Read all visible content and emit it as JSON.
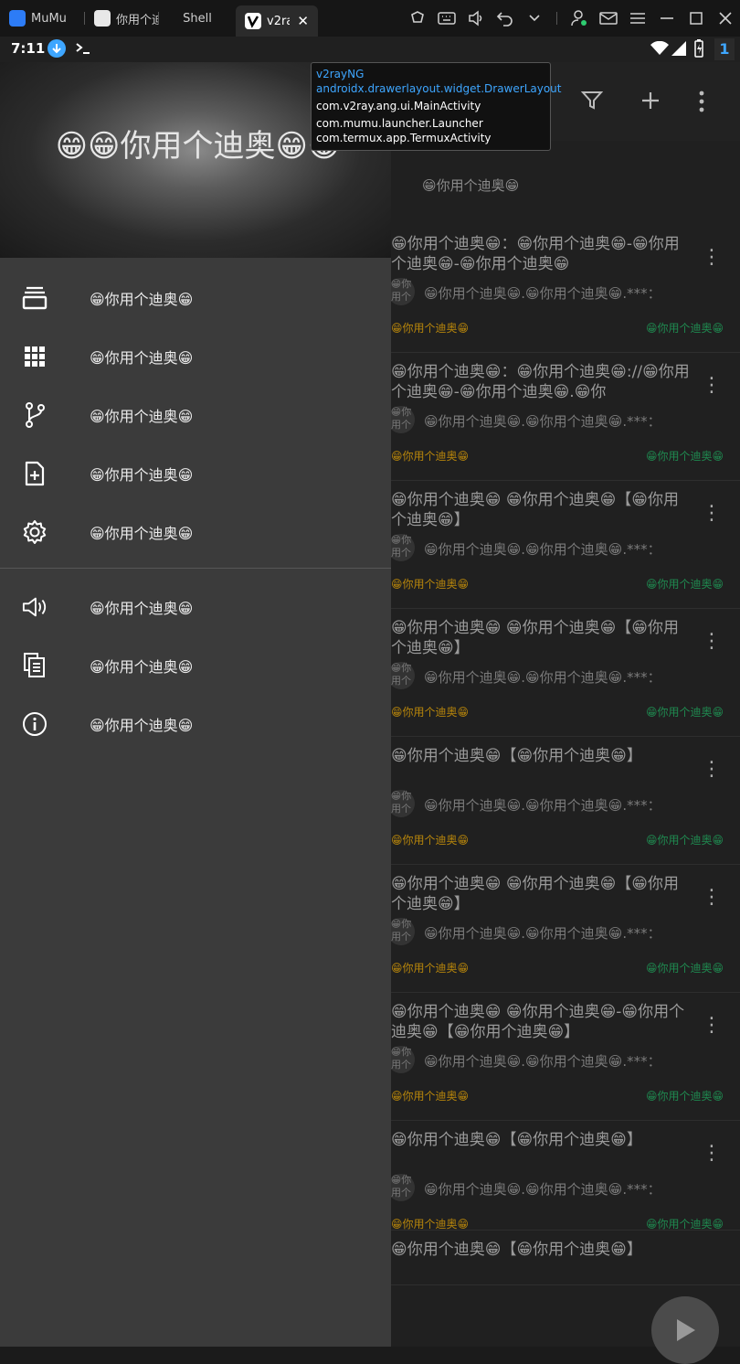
{
  "emulator": {
    "tabs": [
      {
        "label": "MuMu",
        "color": "#2d7cf6"
      },
      {
        "label": "你用个迪",
        "color": "#e8e8e8"
      },
      {
        "label": "Shell",
        "color": ""
      },
      {
        "label": "v2ra",
        "color": "#ffffff"
      }
    ],
    "close_symbol": "✕"
  },
  "statusbar": {
    "time": "7:11",
    "badge": "1"
  },
  "drawer": {
    "header_title": "😁😁你用个迪奥😁😁",
    "items": [
      {
        "icon": "layers-icon",
        "label": "😁你用个迪奥😁"
      },
      {
        "icon": "apps-grid-icon",
        "label": "😁你用个迪奥😁"
      },
      {
        "icon": "branch-icon",
        "label": "😁你用个迪奥😁"
      },
      {
        "icon": "add-file-icon",
        "label": "😁你用个迪奥😁"
      },
      {
        "icon": "gear-icon",
        "label": "😁你用个迪奥😁"
      },
      {
        "icon": "speaker-icon",
        "label": "😁你用个迪奥😁"
      },
      {
        "icon": "logcat-icon",
        "label": "😁你用个迪奥😁"
      },
      {
        "icon": "info-icon",
        "label": "😁你用个迪奥😁"
      }
    ]
  },
  "list": {
    "group_header": "😁你用个迪奥😁",
    "cards": [
      {
        "title": "😁你用个迪奥😁：😁你用个迪奥😁-😁你用个迪奥😁-😁你用个迪奥😁",
        "avatar": "😁你用个",
        "sub": "😁你用个迪奥😁.😁你用个迪奥😁.***：",
        "foot_left": "😁你用个迪奥😁",
        "foot_right": "😁你用个迪奥😁"
      },
      {
        "title": "😁你用个迪奥😁：😁你用个迪奥😁://😁你用个迪奥😁-😁你用个迪奥😁.😁你",
        "avatar": "😁你用个",
        "sub": "😁你用个迪奥😁.😁你用个迪奥😁.***：",
        "foot_left": "😁你用个迪奥😁",
        "foot_right": "😁你用个迪奥😁"
      },
      {
        "title": "😁你用个迪奥😁 😁你用个迪奥😁【😁你用个迪奥😁】",
        "avatar": "😁你用个",
        "sub": "😁你用个迪奥😁.😁你用个迪奥😁.***：",
        "foot_left": "😁你用个迪奥😁",
        "foot_right": "😁你用个迪奥😁"
      },
      {
        "title": "😁你用个迪奥😁 😁你用个迪奥😁【😁你用个迪奥😁】",
        "avatar": "😁你用个",
        "sub": "😁你用个迪奥😁.😁你用个迪奥😁.***：",
        "foot_left": "😁你用个迪奥😁",
        "foot_right": "😁你用个迪奥😁"
      },
      {
        "title": "😁你用个迪奥😁【😁你用个迪奥😁】",
        "avatar": "😁你用个",
        "sub": "😁你用个迪奥😁.😁你用个迪奥😁.***：",
        "foot_left": "😁你用个迪奥😁",
        "foot_right": "😁你用个迪奥😁"
      },
      {
        "title": "😁你用个迪奥😁 😁你用个迪奥😁【😁你用个迪奥😁】",
        "avatar": "😁你用个",
        "sub": "😁你用个迪奥😁.😁你用个迪奥😁.***：",
        "foot_left": "😁你用个迪奥😁",
        "foot_right": "😁你用个迪奥😁"
      },
      {
        "title": "😁你用个迪奥😁 😁你用个迪奥😁-😁你用个迪奥😁【😁你用个迪奥😁】",
        "avatar": "😁你用个",
        "sub": "😁你用个迪奥😁.😁你用个迪奥😁.***：",
        "foot_left": "😁你用个迪奥😁",
        "foot_right": "😁你用个迪奥😁"
      },
      {
        "title": "😁你用个迪奥😁【😁你用个迪奥😁】",
        "avatar": "😁你用个",
        "sub": "😁你用个迪奥😁.😁你用个迪奥😁.***：",
        "foot_left": "😁你用个迪奥😁",
        "foot_right": "😁你用个迪奥😁"
      },
      {
        "title": "😁你用个迪奥😁【😁你用个迪奥😁】"
      }
    ]
  },
  "overlay": {
    "lines": [
      "v2rayNG",
      "androidx.drawerlayout.widget.DrawerLayout",
      "com.v2ray.ang.ui.MainActivity",
      "com.mumu.launcher.Launcher",
      "com.termux.app.TermuxActivity"
    ]
  },
  "colors": {
    "foot_left": "#b8860b",
    "foot_right": "#1f8a50",
    "overlay_blue": "#3ea6ff"
  }
}
